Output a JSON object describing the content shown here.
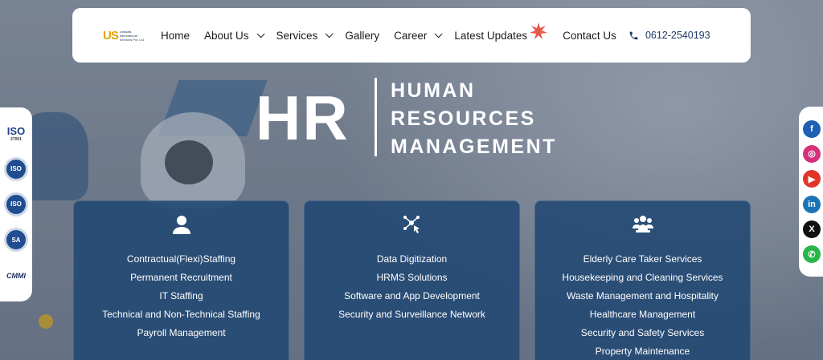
{
  "brand": {
    "logo_mark": "US",
    "logo_text": "Uniskills International Services Pvt. Ltd."
  },
  "nav": {
    "items": [
      {
        "label": "Home",
        "dropdown": false
      },
      {
        "label": "About Us",
        "dropdown": true
      },
      {
        "label": "Services",
        "dropdown": true
      },
      {
        "label": "Gallery",
        "dropdown": false
      },
      {
        "label": "Career",
        "dropdown": true
      },
      {
        "label": "Latest Updates",
        "dropdown": false,
        "badge": "NEW"
      },
      {
        "label": "Contact Us",
        "dropdown": false
      }
    ],
    "phone": "0612-2540193"
  },
  "hero": {
    "title": "HR",
    "subtitle_lines": [
      "HUMAN",
      "RESOURCES",
      "MANAGEMENT"
    ]
  },
  "certifications": [
    {
      "label": "ISO",
      "sub": "27001"
    },
    {
      "label": "ISO"
    },
    {
      "label": "ISO"
    },
    {
      "label": "SA"
    },
    {
      "label": "CMMI"
    }
  ],
  "social": [
    "facebook",
    "instagram",
    "youtube",
    "linkedin",
    "x",
    "whatsapp"
  ],
  "cards": [
    {
      "icon": "user-icon",
      "items": [
        "Contractual(Flexi)Staffing",
        "Permanent Recruitment",
        "IT Staffing",
        "Technical and Non-Technical Staffing",
        "Payroll Management"
      ]
    },
    {
      "icon": "digital-network-icon",
      "items": [
        "Data Digitization",
        "HRMS Solutions",
        "Software and App Development",
        "Security and Surveillance Network"
      ]
    },
    {
      "icon": "team-icon",
      "items": [
        "Elderly Care Taker Services",
        "Housekeeping and Cleaning Services",
        "Waste Management and Hospitality",
        "Healthcare Management",
        "Security and Safety Services",
        "Property Maintenance"
      ]
    }
  ],
  "colors": {
    "card_bg": "#254a74",
    "nav_bg": "#ffffff",
    "accent_badge": "#e8574b"
  }
}
